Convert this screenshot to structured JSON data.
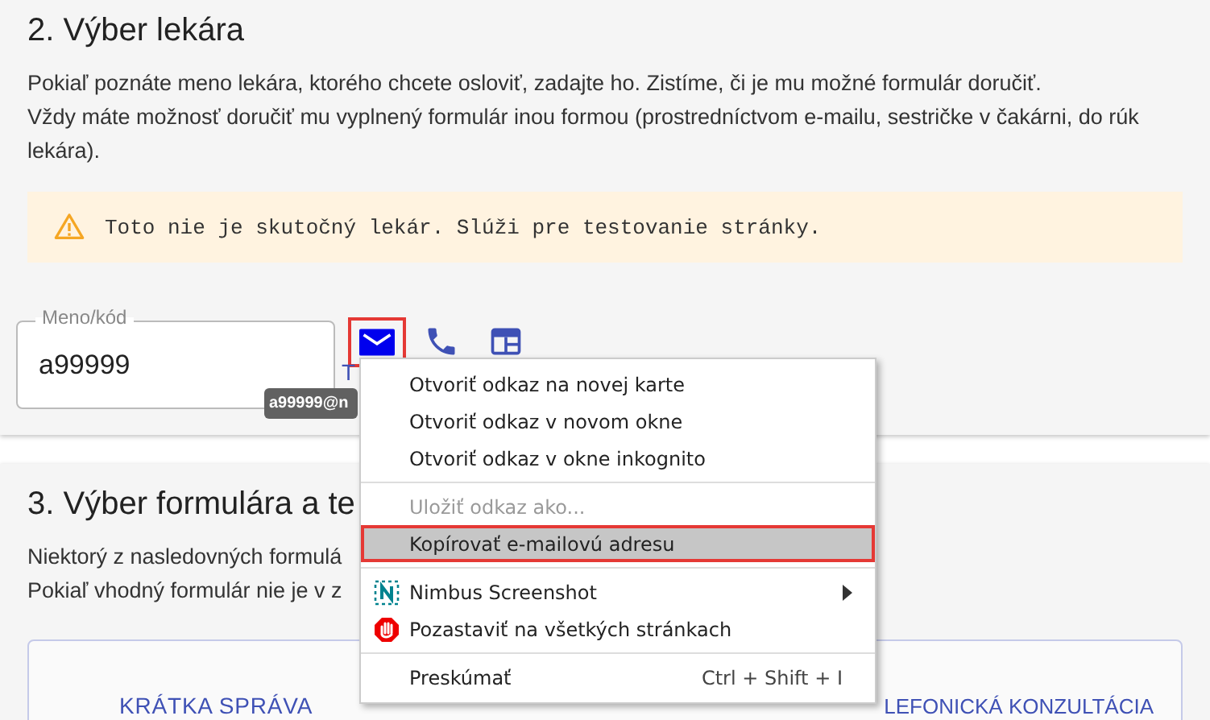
{
  "section_doctor": {
    "heading": "2. Výber lekára",
    "intro": [
      "Pokiaľ poznáte meno lekára, ktorého chcete osloviť, zadajte ho. Zistíme, či je mu možné formulár doručiť.",
      "Vždy máte možnosť doručiť mu vyplnený formulár inou formou (prostredníctvom e-mailu, sestričke v čakárni, do rúk lekára)."
    ],
    "warning": "Toto nie je skutočný lekár. Slúži pre testovanie stránky.",
    "field": {
      "label": "Meno/kód",
      "value": "a99999"
    },
    "contact_icons": [
      {
        "kind": "mail",
        "highlighted": true
      },
      {
        "kind": "phone",
        "highlighted": false
      },
      {
        "kind": "window",
        "highlighted": false
      }
    ],
    "link_text": "T",
    "tooltip": "a99999@n"
  },
  "section_form": {
    "heading": "3. Výber formulára a te",
    "intro": [
      "Niektorý z nasledovných formulá",
      "Pokiaľ vhodný formulár nie je v z"
    ],
    "tabs": [
      {
        "label": "KRÁTKA SPRÁVA"
      },
      {
        "label": "LEFONICKÁ KONZULTÁCIA"
      }
    ]
  },
  "context_menu": [
    {
      "kind": "plain",
      "label": "Otvoriť odkaz na novej karte",
      "disabled": false,
      "highlighted": false
    },
    {
      "kind": "plain",
      "label": "Otvoriť odkaz v novom okne",
      "disabled": false,
      "highlighted": false
    },
    {
      "kind": "plain",
      "label": "Otvoriť odkaz v okne inkognito",
      "disabled": false,
      "highlighted": false
    },
    {
      "kind": "separator"
    },
    {
      "kind": "plain",
      "label": "Uložiť odkaz ako...",
      "disabled": true,
      "highlighted": false
    },
    {
      "kind": "plain",
      "label": "Kopírovať e-mailovú adresu",
      "disabled": false,
      "highlighted": true
    },
    {
      "kind": "separator"
    },
    {
      "kind": "nimbus",
      "label": "Nimbus Screenshot",
      "disabled": false,
      "highlighted": false,
      "submenu": true
    },
    {
      "kind": "blocker",
      "label": "Pozastaviť na všetkých stránkach",
      "disabled": false,
      "highlighted": false
    },
    {
      "kind": "separator"
    },
    {
      "kind": "plain",
      "label": "Preskúmať",
      "shortcut": "Ctrl + Shift + I",
      "disabled": false,
      "highlighted": false
    }
  ]
}
